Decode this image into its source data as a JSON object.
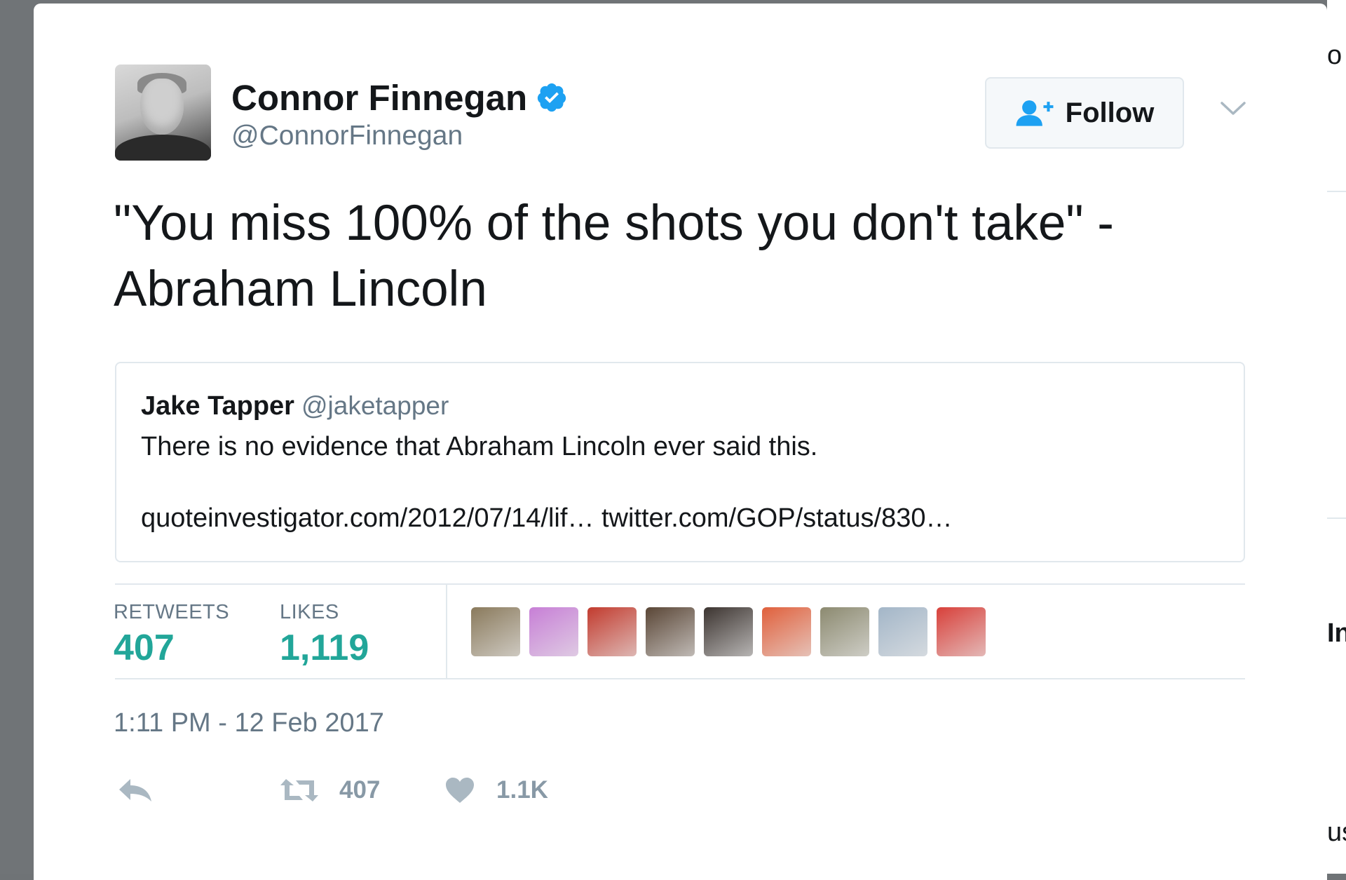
{
  "tweet": {
    "author": {
      "display_name": "Connor Finnegan",
      "handle": "@ConnorFinnegan",
      "verified": true
    },
    "follow_label": "Follow",
    "text": "\"You miss 100% of the shots you don't take\" -\nAbraham Lincoln",
    "quoted": {
      "display_name": "Jake Tapper",
      "handle": "@jaketapper",
      "text": "There is no evidence that Abraham Lincoln ever said this.",
      "links": "quoteinvestigator.com/2012/07/14/lif… twitter.com/GOP/status/830…"
    },
    "stats": {
      "retweets_label": "RETWEETS",
      "retweets_value": "407",
      "likes_label": "LIKES",
      "likes_value": "1,119"
    },
    "likers": [
      {
        "color": "#8a7a5c"
      },
      {
        "color": "#c77fd6"
      },
      {
        "color": "#c23b2e"
      },
      {
        "color": "#5a4636"
      },
      {
        "color": "#3c3430"
      },
      {
        "color": "#e0603c"
      },
      {
        "color": "#8c8a70"
      },
      {
        "color": "#a3b6c8"
      },
      {
        "color": "#d8403a"
      }
    ],
    "timestamp": "1:11 PM - 12 Feb 2017",
    "actions": {
      "retweet_count": "407",
      "like_count": "1.1K"
    }
  },
  "background_fragments": {
    "top": "o",
    "middle": "In",
    "bottom": "us"
  },
  "colors": {
    "verified_blue": "#1da1f2",
    "stat_teal": "#22a699",
    "icon_gray": "#8899a6"
  }
}
